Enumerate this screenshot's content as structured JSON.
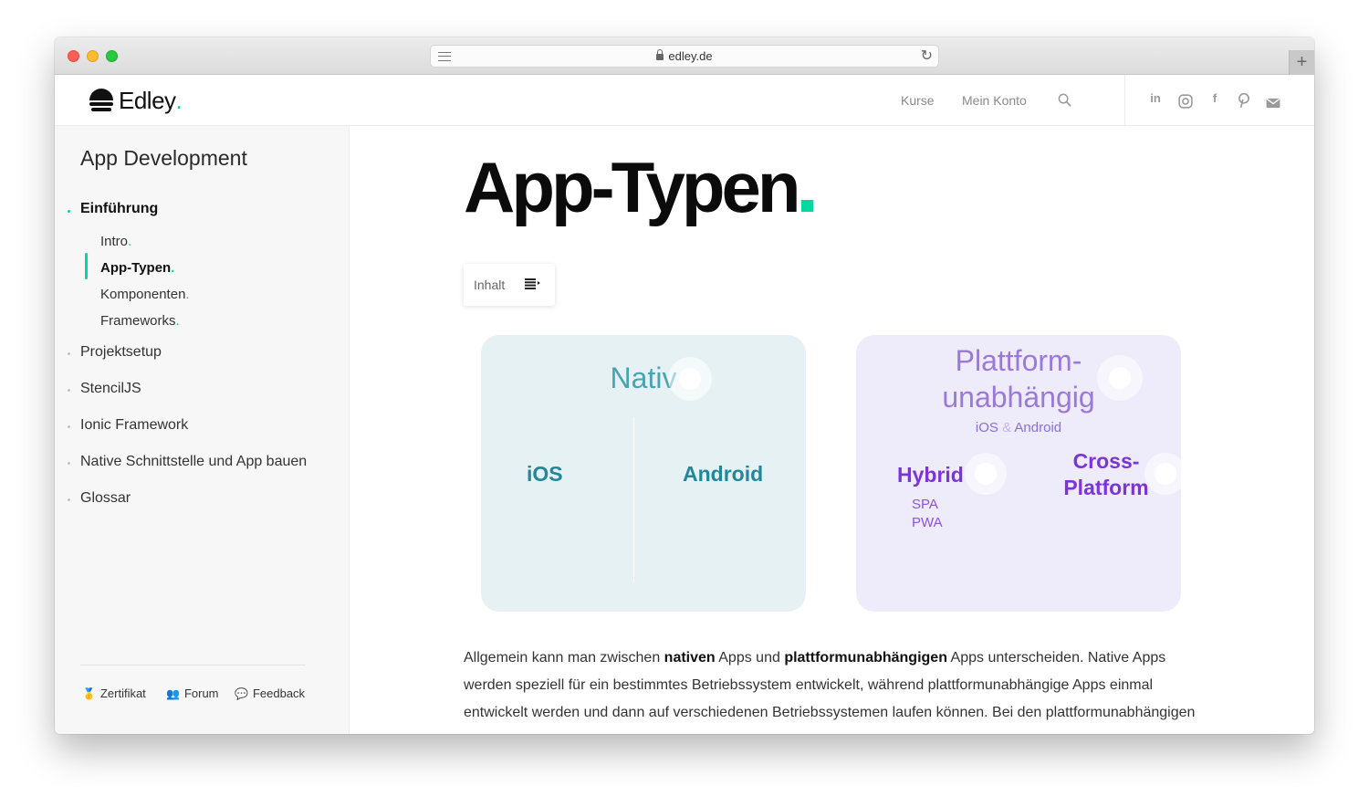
{
  "browser": {
    "url": "edley.de"
  },
  "header": {
    "logo_text": "Edley",
    "logo_dot": ".",
    "nav": {
      "kurse": "Kurse",
      "konto": "Mein Konto"
    },
    "social_icons": [
      "linkedin-icon",
      "instagram-icon",
      "facebook-icon",
      "pinterest-icon",
      "mail-icon"
    ]
  },
  "sidebar": {
    "course_title": "App Development",
    "sections": [
      {
        "label": "Einführung",
        "active": true
      },
      {
        "label": "Projektsetup"
      },
      {
        "label": "StencilJS"
      },
      {
        "label": "Ionic Framework"
      },
      {
        "label": "Native Schnittstelle und App bauen"
      },
      {
        "label": "Glossar"
      }
    ],
    "lessons": [
      {
        "label": "Intro"
      },
      {
        "label": "App-Typen",
        "active": true
      },
      {
        "label": "Komponenten"
      },
      {
        "label": "Frameworks"
      }
    ],
    "lesson_dot": ".",
    "footer": {
      "zertifikat": "Zertifikat",
      "forum": "Forum",
      "feedback": "Feedback"
    }
  },
  "main": {
    "title": "App-Typen",
    "toc_label": "Inhalt",
    "native_card": {
      "title": "Nativ",
      "left": "iOS",
      "right": "Android"
    },
    "cross_card": {
      "title_line1": "Plattform-",
      "title_line2": "unabhängig",
      "sub_ios": "iOS",
      "sub_amp": "&",
      "sub_android": "Android",
      "hybrid": "Hybrid",
      "hybrid_items": [
        "SPA",
        "PWA"
      ],
      "cross_line1": "Cross-",
      "cross_line2": "Platform"
    },
    "paragraph": {
      "t1": "Allgemein kann man zwischen ",
      "b1": "nativen",
      "t2": " Apps und ",
      "b2": "plattformunabhängigen",
      "t3": " Apps unterscheiden. Native Apps werden speziell für ein bestimmtes Betriebssystem entwickelt, während plattformunabhängige Apps einmal entwickelt werden und dann auf verschiedenen Betriebssystemen laufen können. Bei den plattformunabhängigen"
    }
  },
  "colors": {
    "accent": "#00d9a0",
    "native_bg": "#e6f1f3",
    "native_text": "#22879b",
    "cross_bg": "#eeebfa",
    "cross_text": "#7b35d6"
  }
}
